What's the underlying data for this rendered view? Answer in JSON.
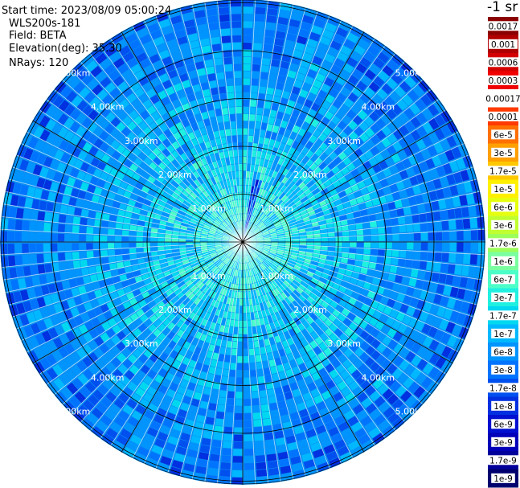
{
  "header": {
    "start_time": "Start time: 2023/08/09 05:00:24",
    "instrument": "WLS200s-181",
    "field": "Field: BETA",
    "elevation": "Elevation(deg): 35.30",
    "nrays": "NRays: 120"
  },
  "units": "-1 sr",
  "chart_data": {
    "type": "heatmap",
    "projection": "polar-ppi",
    "field": "BETA",
    "elevation_deg": 35.3,
    "n_rays": 120,
    "max_range_km": 5.0,
    "range_rings_km": [
      1,
      2,
      3,
      4,
      5
    ],
    "ring_labels": [
      "1.00km",
      "2.00km",
      "3.00km",
      "4.00km",
      "5.00km"
    ],
    "spokes_deg": [
      0,
      30,
      60,
      90,
      120,
      150,
      180,
      210,
      240,
      270,
      300,
      330
    ],
    "dominant_values": {
      "near_range": "1e-7 to 3e-7",
      "mid_range": "1e-8 to 1e-7",
      "far_range": "1e-9 to 3e-8",
      "enhanced_sector_deg": [
        8,
        18
      ]
    },
    "colorbar": {
      "labels": [
        "0.0017",
        "0.001",
        "0.0006",
        "0.0003",
        "0.00017",
        "0.0001",
        "6e-5",
        "3e-5",
        "1.7e-5",
        "1e-5",
        "6e-6",
        "3e-6",
        "1.7e-6",
        "1e-6",
        "6e-7",
        "3e-7",
        "1.7e-7",
        "1e-7",
        "6e-8",
        "3e-8",
        "1.7e-8",
        "1e-8",
        "6e-9",
        "3e-9",
        "1.7e-9",
        "1e-9"
      ],
      "colors": [
        "#8b0000",
        "#b00000",
        "#d40000",
        "#f00000",
        "#ffffff",
        "#ff3a00",
        "#ff7000",
        "#ff9f00",
        "#ffc800",
        "#fff000",
        "#e6ff10",
        "#c0ff30",
        "#9cff5a",
        "#7affa0",
        "#4cffc8",
        "#20f0e0",
        "#00d8f0",
        "#00b8ff",
        "#0094ff",
        "#0074ff",
        "#0050f0",
        "#0030e0",
        "#0010d0",
        "#0000b8",
        "#00009a",
        "#00006e"
      ]
    }
  }
}
